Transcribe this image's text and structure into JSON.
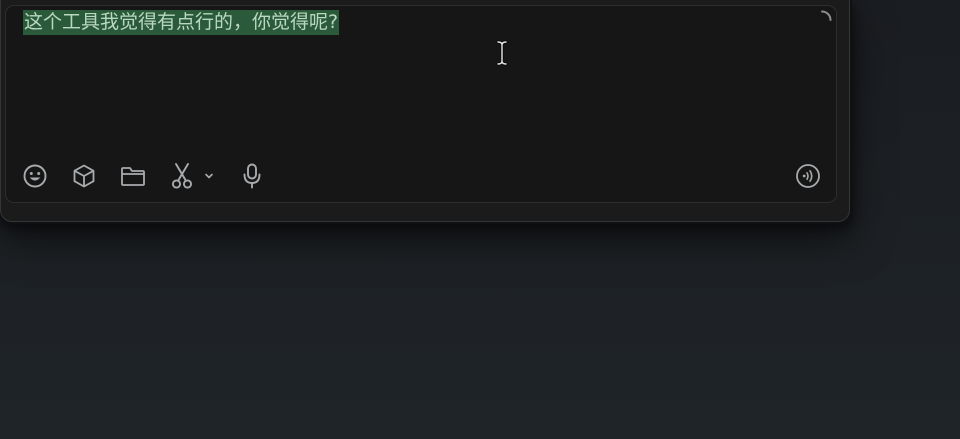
{
  "input": {
    "value": "这个工具我觉得有点行的，你觉得呢?"
  },
  "colors": {
    "selection": "#2b5a3a",
    "text": "#b9d8c0",
    "icon": "#a8abae"
  },
  "toolbar": {
    "icons": [
      "emoji-icon",
      "cube-icon",
      "folder-icon",
      "scissors-icon",
      "chevron-down-icon",
      "microphone-icon",
      "voice-icon"
    ]
  }
}
